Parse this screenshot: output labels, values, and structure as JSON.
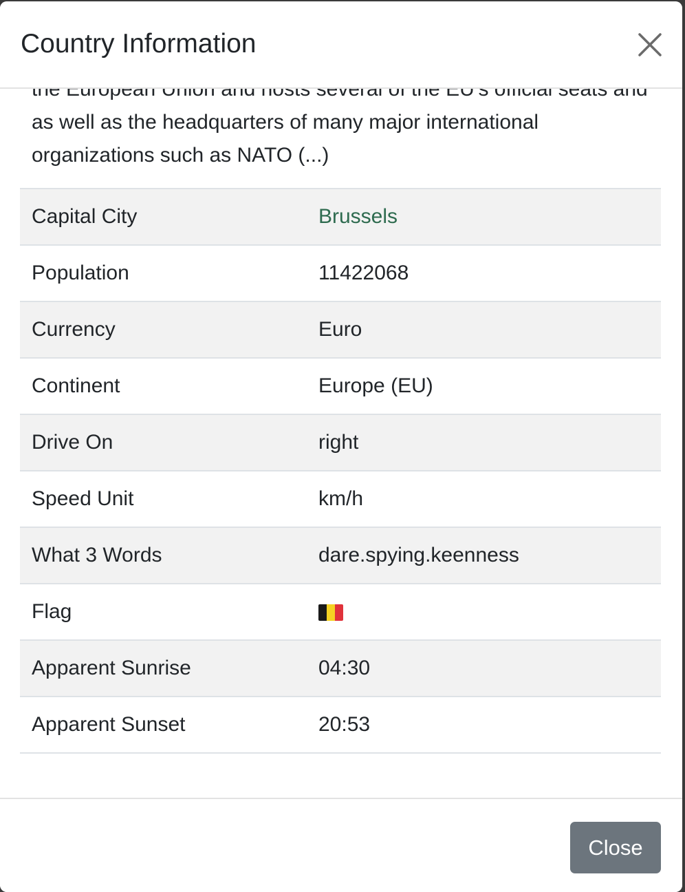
{
  "modal": {
    "title": "Country Information",
    "summary": "the European Union and hosts several of the EU's official seats and as well as the headquarters of many major international organizations such as NATO (...)",
    "close_label": "Close"
  },
  "table": {
    "rows": [
      {
        "label": "Capital City",
        "value": "Brussels"
      },
      {
        "label": "Population",
        "value": "11422068"
      },
      {
        "label": "Currency",
        "value": "Euro"
      },
      {
        "label": "Continent",
        "value": "Europe (EU)"
      },
      {
        "label": "Drive On",
        "value": "right"
      },
      {
        "label": "Speed Unit",
        "value": "km/h"
      },
      {
        "label": "What 3 Words",
        "value": "dare.spying.keenness"
      },
      {
        "label": "Flag",
        "flag_colors": [
          "#1a1a1a",
          "#f5d223",
          "#e0323b"
        ]
      },
      {
        "label": "Apparent Sunrise",
        "value": "04:30"
      },
      {
        "label": "Apparent Sunset",
        "value": "20:53"
      }
    ]
  },
  "colors": {
    "link": "#2e6b4f",
    "button_bg": "#6c757d",
    "stripe_bg": "#f2f2f2"
  }
}
